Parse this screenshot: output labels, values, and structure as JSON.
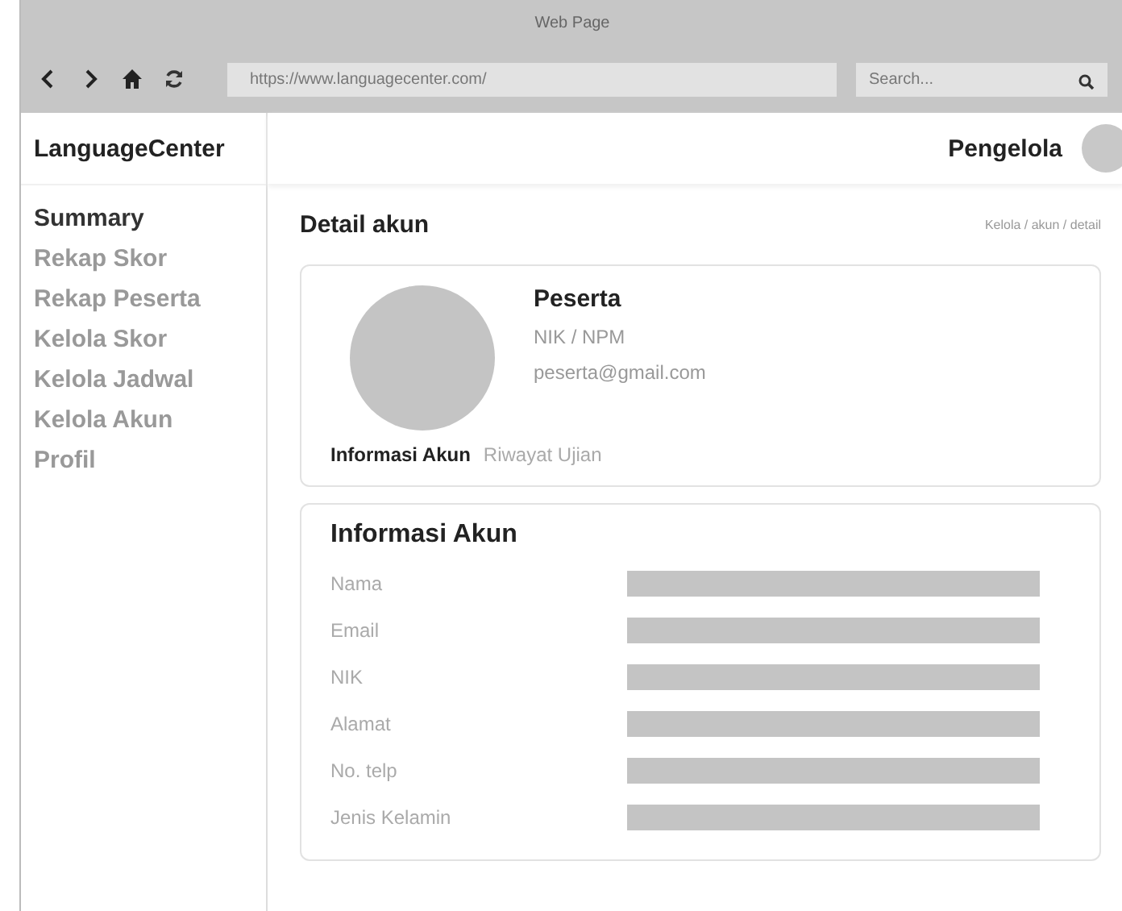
{
  "window": {
    "title": "Web Page"
  },
  "toolbar": {
    "url": "https://www.languagecenter.com/",
    "search": {
      "placeholder": "Search..."
    }
  },
  "sidebar": {
    "brand": "LanguageCenter",
    "items": [
      {
        "label": "Summary",
        "selected": true
      },
      {
        "label": "Rekap Skor",
        "selected": false
      },
      {
        "label": "Rekap Peserta",
        "selected": false
      },
      {
        "label": "Kelola Skor",
        "selected": false
      },
      {
        "label": "Kelola Jadwal",
        "selected": false
      },
      {
        "label": "Kelola Akun",
        "selected": false
      },
      {
        "label": "Profil",
        "selected": false
      }
    ]
  },
  "header": {
    "user": "Pengelola"
  },
  "page": {
    "title": "Detail akun",
    "breadcrumb": "Kelola / akun / detail"
  },
  "profile": {
    "name": "Peserta",
    "id": "NIK / NPM",
    "email": "peserta@gmail.com",
    "tabs": [
      {
        "label": "Informasi Akun",
        "selected": true
      },
      {
        "label": "Riwayat Ujian",
        "selected": false
      }
    ]
  },
  "info": {
    "title": "Informasi Akun",
    "fields": [
      {
        "label": "Nama"
      },
      {
        "label": "Email"
      },
      {
        "label": "NIK"
      },
      {
        "label": "Alamat"
      },
      {
        "label": "No. telp"
      },
      {
        "label": "Jenis Kelamin"
      }
    ]
  }
}
